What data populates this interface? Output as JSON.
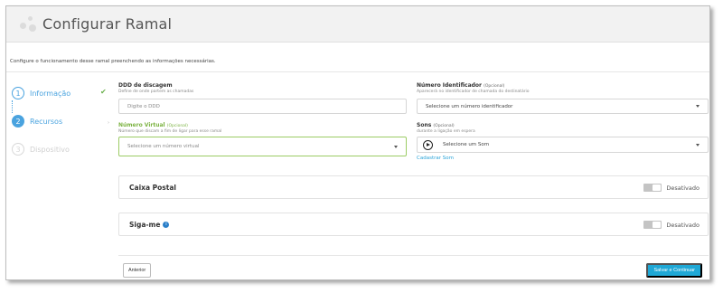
{
  "header": {
    "title": "Configurar Ramal"
  },
  "subtitle": "Configure o funcionamento desse ramal preenchendo as informações necessárias.",
  "steps": [
    {
      "number": "1",
      "label": "Informação",
      "state": "done"
    },
    {
      "number": "2",
      "label": "Recursos",
      "state": "active"
    },
    {
      "number": "3",
      "label": "Dispositivo",
      "state": "disabled"
    }
  ],
  "form": {
    "ddd": {
      "label": "DDD de discagem",
      "help": "Define de onde partem as chamadas",
      "placeholder": "Digite o DDD"
    },
    "identificador": {
      "label": "Número Identificador",
      "optional": "(Opcional)",
      "help": "Aparecerá no identificador de chamada do destinatário",
      "value": "Selecione um número identificador"
    },
    "numero_virtual": {
      "label": "Número Virtual",
      "optional": "(Opcional)",
      "help": "Número que discam a fim de ligar para esse ramal",
      "value": "Selecione um número virtual"
    },
    "sons": {
      "label": "Sons",
      "optional": "(Opcional)",
      "help": "durante a ligação em espera",
      "value": "Selecione um Som",
      "link": "Cadastrar Som"
    }
  },
  "panels": [
    {
      "title": "Caixa Postal",
      "status": "Desativado"
    },
    {
      "title": "Siga-me",
      "info_icon": "i",
      "status": "Desativado"
    }
  ],
  "footer": {
    "prev": "Anterior",
    "next": "Salvar e Continuar"
  },
  "colors": {
    "accent": "#4aa3df",
    "success": "#7cb342",
    "primary_button": "#1fa8d6",
    "toggle_off": "#c4c4c4"
  }
}
